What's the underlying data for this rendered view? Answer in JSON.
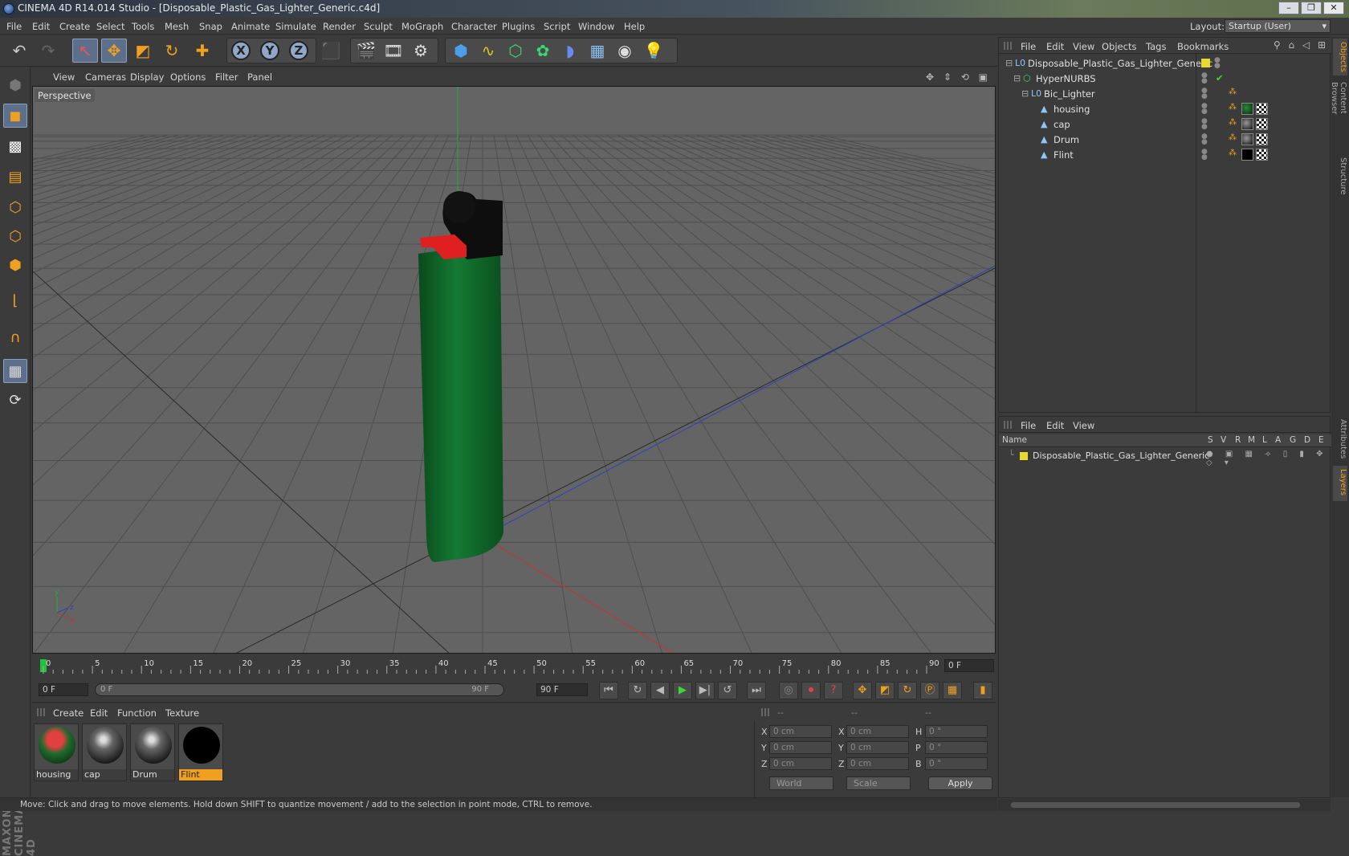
{
  "window": {
    "title": "CINEMA 4D R14.014 Studio - [Disposable_Plastic_Gas_Lighter_Generic.c4d]",
    "controls": [
      "–",
      "❐",
      "✕"
    ]
  },
  "menubar": {
    "items": [
      "File",
      "Edit",
      "Create",
      "Select",
      "Tools",
      "Mesh",
      "Snap",
      "Animate",
      "Simulate",
      "Render",
      "Sculpt",
      "MoGraph",
      "Character",
      "Plugins",
      "Script",
      "Window",
      "Help"
    ],
    "layout_label": "Layout:",
    "layout_value": "Startup (User)"
  },
  "toolbar": {
    "axes": [
      "X",
      "Y",
      "Z"
    ]
  },
  "viewport": {
    "menu": [
      "View",
      "Cameras",
      "Display",
      "Options",
      "Filter",
      "Panel"
    ],
    "label": "Perspective",
    "axis_labels": {
      "x": "x",
      "y": "y",
      "z": "z"
    },
    "colors": {
      "bg": "#646464",
      "grid": "#4e4e4e",
      "housing": "#0f6a2a",
      "cap": "#111111",
      "lever": "#e02020",
      "axis_y": "#20b040",
      "axis_x": "#d03030",
      "axis_z": "#3040c0"
    }
  },
  "timeline": {
    "ticks": [
      "0",
      "5",
      "10",
      "15",
      "20",
      "25",
      "30",
      "35",
      "40",
      "45",
      "50",
      "55",
      "60",
      "65",
      "70",
      "75",
      "80",
      "85",
      "90"
    ],
    "current": "0 F",
    "start": "0 F",
    "range_start": "0 F",
    "range_end": "90 F",
    "end": "90 F"
  },
  "transport": {
    "buttons": [
      "⏮",
      "↻",
      "◀",
      "▶",
      "▶|",
      "↺",
      "⏭"
    ]
  },
  "materials": {
    "menu": [
      "Create",
      "Edit",
      "Function",
      "Texture"
    ],
    "items": [
      {
        "name": "housing",
        "selected": false
      },
      {
        "name": "cap",
        "selected": false
      },
      {
        "name": "Drum",
        "selected": false
      },
      {
        "name": "Flint",
        "selected": true
      }
    ]
  },
  "coords": {
    "header": [
      "--",
      "--",
      "--"
    ],
    "rows": [
      {
        "l1": "X",
        "v1": "0 cm",
        "l2": "X",
        "v2": "0 cm",
        "l3": "H",
        "v3": "0 °"
      },
      {
        "l1": "Y",
        "v1": "0 cm",
        "l2": "Y",
        "v2": "0 cm",
        "l3": "P",
        "v3": "0 °"
      },
      {
        "l1": "Z",
        "v1": "0 cm",
        "l2": "Z",
        "v2": "0 cm",
        "l3": "B",
        "v3": "0 °"
      }
    ],
    "mode1": "World",
    "mode2": "Scale",
    "apply": "Apply"
  },
  "status": "Move: Click and drag to move elements. Hold down SHIFT to quantize movement / add to the selection in point mode, CTRL to remove.",
  "objects": {
    "menu": [
      "File",
      "Edit",
      "View",
      "Objects",
      "Tags",
      "Bookmarks"
    ],
    "rows": [
      {
        "name": "Disposable_Plastic_Gas_Lighter_Generic",
        "indent": 0
      },
      {
        "name": "HyperNURBS",
        "indent": 1
      },
      {
        "name": "Bic_Lighter",
        "indent": 2
      },
      {
        "name": "housing",
        "indent": 3
      },
      {
        "name": "cap",
        "indent": 3
      },
      {
        "name": "Drum",
        "indent": 3
      },
      {
        "name": "Flint",
        "indent": 3
      }
    ]
  },
  "layers": {
    "menu": [
      "File",
      "Edit",
      "View"
    ],
    "columns": [
      "Name",
      "S",
      "V",
      "R",
      "M",
      "L",
      "A",
      "G",
      "D",
      "E"
    ],
    "rows": [
      {
        "name": "Disposable_Plastic_Gas_Lighter_Generic"
      }
    ]
  },
  "sidetabs": [
    "Objects",
    "Content Browser",
    "Structure",
    "Attributes",
    "Layers"
  ]
}
